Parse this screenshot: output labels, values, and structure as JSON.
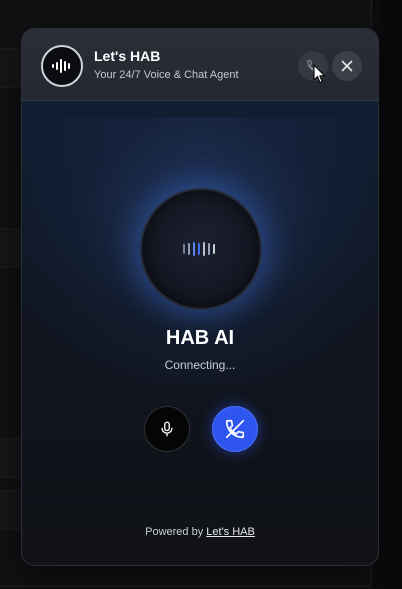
{
  "widget": {
    "title": "Let's HAB",
    "subtitle": "Your 24/7 Voice & Chat Agent",
    "agent_name": "HAB AI",
    "status": "Connecting...",
    "powered_by_prefix": "Powered by",
    "powered_by_link": "Let's HAB"
  },
  "icons": {
    "logo": "waveform-icon",
    "call": "phone-icon",
    "close": "close-icon",
    "orb": "waveform-icon",
    "mic": "microphone-icon",
    "end_call": "phone-off-icon"
  },
  "colors": {
    "accent": "#2f55f0",
    "header_bg": "#262b33",
    "panel_bg": "#111317",
    "orb_glow": "#3c6edc"
  }
}
